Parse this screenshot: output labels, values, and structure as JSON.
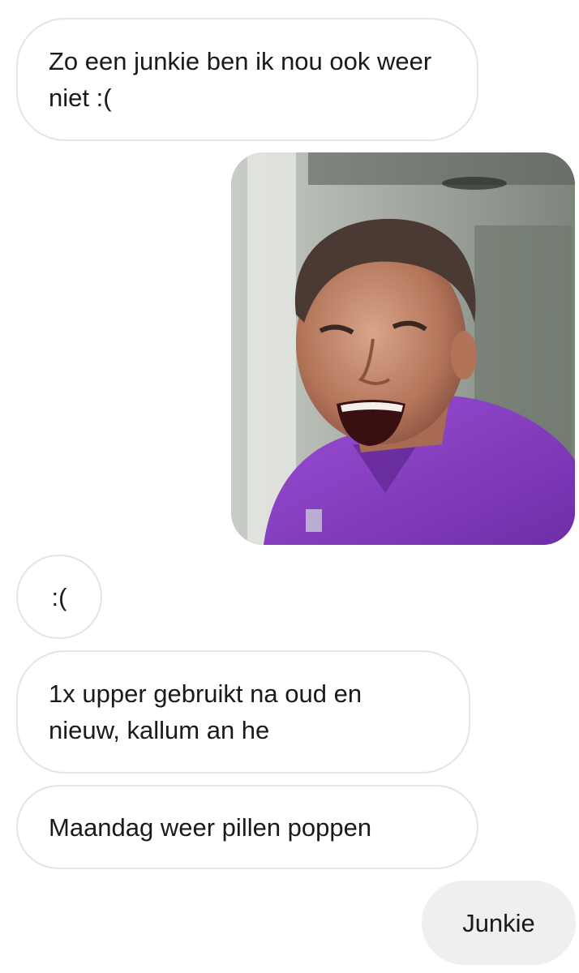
{
  "messages": {
    "m1": {
      "text": "Zo een junkie ben ik nou ook weer niet :(",
      "direction": "incoming"
    },
    "m2": {
      "type": "image",
      "subject": "laughing man in purple polo shirt",
      "direction": "outgoing"
    },
    "m3": {
      "text": ":(",
      "direction": "incoming"
    },
    "m4": {
      "text": "1x upper gebruikt na oud en nieuw, kallum an he",
      "direction": "incoming"
    },
    "m5": {
      "text": "Maandag weer pillen poppen",
      "direction": "incoming"
    },
    "m6": {
      "text": "Junkie",
      "direction": "outgoing"
    }
  },
  "colors": {
    "background": "#ffffff",
    "incoming_bubble": "#ffffff",
    "incoming_border": "#e4e4e4",
    "outgoing_bubble": "#efefef",
    "text": "#1a1a1a",
    "shirt": "#8a3fc6"
  }
}
